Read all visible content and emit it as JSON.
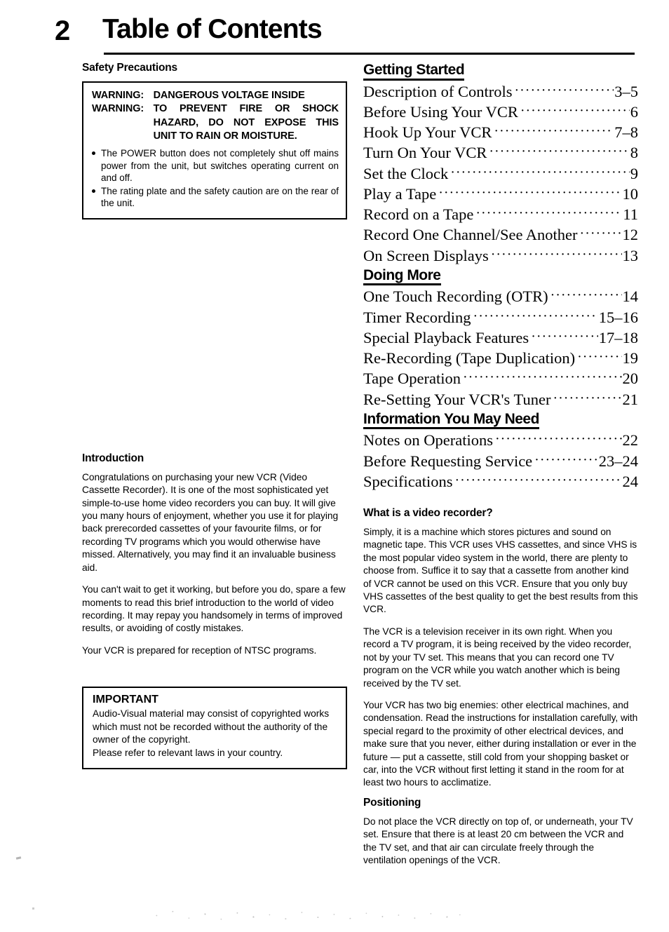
{
  "page": {
    "number": "2",
    "title": "Table of Contents"
  },
  "left_column": {
    "safety_heading": "Safety Precautions",
    "warning_box": {
      "lines": [
        {
          "label": "WARNING:",
          "text": "DANGEROUS VOLTAGE INSIDE"
        },
        {
          "label": "WARNING:",
          "text": "TO PREVENT FIRE OR SHOCK"
        },
        {
          "label": "",
          "text": "HAZARD, DO NOT EXPOSE THIS"
        },
        {
          "label": "",
          "text": "UNIT TO RAIN OR MOISTURE."
        }
      ],
      "bullets": [
        "The POWER button does not completely shut off mains power from the unit, but switches operating current on and off.",
        "The rating plate and the safety caution are on the rear of the unit."
      ]
    },
    "introduction": {
      "heading": "Introduction",
      "paragraphs": [
        "Congratulations on purchasing your new VCR (Video Cassette Recorder). It is one of the most sophisticated yet simple-to-use home video recorders you can buy. It will give you many hours of enjoyment, whether you use it for playing back prerecorded cassettes of your favourite films, or for recording TV programs which you would otherwise have missed. Alternatively, you may find it an invaluable business aid.",
        "You can't wait to get it working, but before you do, spare a few moments to read this brief introduction to the world of video recording. It may repay you handsomely in terms of improved results, or avoiding of costly mistakes.",
        "Your VCR is prepared for reception of NTSC programs."
      ]
    },
    "important_box": {
      "title": "IMPORTANT",
      "text": "Audio-Visual material may consist of copyrighted works which must not be recorded without the authority of the owner of the copyright.\nPlease refer to relevant laws in your country."
    }
  },
  "right_column": {
    "toc": [
      {
        "heading": "Getting Started",
        "entries": [
          {
            "label": "Description of Controls",
            "page": "3–5"
          },
          {
            "label": "Before Using Your VCR",
            "page": "6"
          },
          {
            "label": "Hook Up Your VCR",
            "page": "7–8"
          },
          {
            "label": "Turn On Your VCR",
            "page": "8"
          },
          {
            "label": "Set the Clock",
            "page": "9"
          },
          {
            "label": "Play a Tape",
            "page": "10"
          },
          {
            "label": "Record on a Tape",
            "page": "11"
          },
          {
            "label": "Record One Channel/See Another",
            "page": "12"
          },
          {
            "label": "On Screen Displays",
            "page": "13"
          }
        ]
      },
      {
        "heading": "Doing More",
        "entries": [
          {
            "label": "One Touch Recording (OTR)",
            "page": "14"
          },
          {
            "label": "Timer Recording",
            "page": "15–16"
          },
          {
            "label": "Special Playback Features",
            "page": "17–18"
          },
          {
            "label": "Re-Recording (Tape Duplication)",
            "page": "19"
          },
          {
            "label": "Tape Operation",
            "page": "20"
          },
          {
            "label": "Re-Setting Your VCR's Tuner",
            "page": "21"
          }
        ]
      },
      {
        "heading": "Information You May Need",
        "entries": [
          {
            "label": "Notes on Operations",
            "page": "22"
          },
          {
            "label": "Before Requesting Service",
            "page": "23–24"
          },
          {
            "label": "Specifications",
            "page": "24"
          }
        ]
      }
    ],
    "what_is": {
      "heading": "What is a video recorder?",
      "paragraphs": [
        "Simply, it is a machine which stores pictures and sound on magnetic tape. This VCR uses VHS cassettes, and since VHS is the most popular video system in the world, there are plenty to choose from. Suffice it to say that a cassette from another kind of VCR cannot be used on this VCR. Ensure that you only buy VHS cassettes of the best quality to get the best results from this VCR.",
        "The VCR is a television receiver in its own right. When you record a TV program, it is being received by the video recorder, not by your TV set. This means that you can record one TV program on the VCR while you watch another which is being received by the TV set.",
        "Your VCR has two big enemies: other electrical machines, and condensation. Read the instructions for installation carefully, with special regard to the proximity of other electrical devices, and make sure that you never, either during installation or ever in the future — put a cassette, still cold from your shopping basket or car, into the VCR without first letting it stand in the room for at least two hours to acclimatize."
      ]
    },
    "positioning": {
      "heading": "Positioning",
      "paragraphs": [
        "Do not place the VCR directly on top of, or underneath, your TV set. Ensure that there is at least 20 cm between the VCR and the TV set, and that air can circulate freely through the ventilation openings of the VCR."
      ]
    }
  },
  "dot_leader": "···························································"
}
